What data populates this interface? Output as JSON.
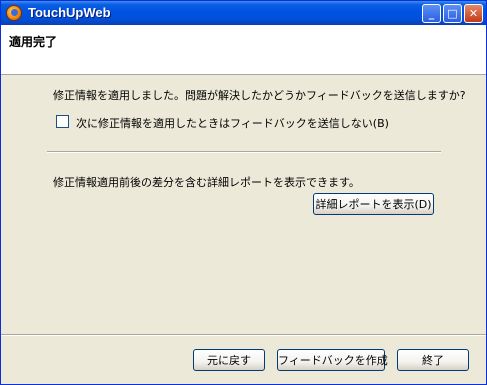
{
  "window": {
    "title": "TouchUpWeb",
    "controls": {
      "minimize": "_",
      "maximize": "□",
      "close": "✕"
    }
  },
  "header": {
    "title": "適用完了"
  },
  "main": {
    "feedback_question": "修正情報を適用しました。問題が解決したかどうかフィードバックを送信しますか?",
    "checkbox": {
      "label": "次に修正情報を適用したときはフィードバックを送信しない(B)",
      "checked": false
    },
    "report_text": "修正情報適用前後の差分を含む詳細レポートを表示できます。",
    "report_button": "詳細レポートを表示(D)"
  },
  "footer": {
    "back_button": "元に戻す",
    "feedback_button": "フィードバックを作成",
    "finish_button": "終了"
  }
}
